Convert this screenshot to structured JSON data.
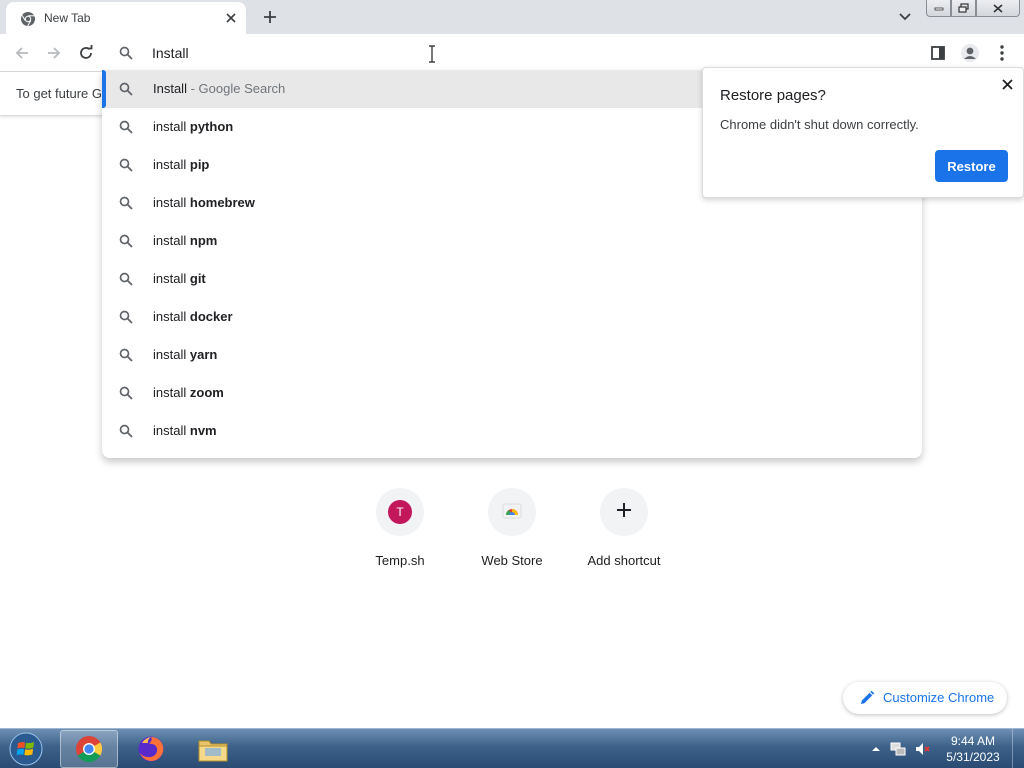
{
  "tab": {
    "title": "New Tab",
    "favicon": "chrome-icon"
  },
  "omnibox": {
    "value": "Install",
    "placeholder": ""
  },
  "infobar": {
    "text": "To get future G"
  },
  "suggestions": [
    {
      "prefix": "Install",
      "bold": "",
      "desc": "- Google Search",
      "selected": true
    },
    {
      "prefix": "install",
      "bold": "python"
    },
    {
      "prefix": "install",
      "bold": "pip"
    },
    {
      "prefix": "install",
      "bold": "homebrew"
    },
    {
      "prefix": "install",
      "bold": "npm"
    },
    {
      "prefix": "install",
      "bold": "git"
    },
    {
      "prefix": "install",
      "bold": "docker"
    },
    {
      "prefix": "install",
      "bold": "yarn"
    },
    {
      "prefix": "install",
      "bold": "zoom"
    },
    {
      "prefix": "install",
      "bold": "nvm"
    }
  ],
  "restore_bubble": {
    "title": "Restore pages?",
    "body": "Chrome didn't shut down correctly.",
    "button": "Restore"
  },
  "shortcuts": [
    {
      "label": "Temp.sh",
      "letter": "T",
      "icon": "letter-tile-icon"
    },
    {
      "label": "Web Store",
      "icon": "web-store-icon"
    },
    {
      "label": "Add shortcut",
      "icon": "plus-icon"
    }
  ],
  "customize": {
    "label": "Customize Chrome",
    "icon": "pencil-icon"
  },
  "taskbar": {
    "apps": [
      "chrome-icon",
      "firefox-icon",
      "file-explorer-icon"
    ],
    "clock": {
      "time": "9:44 AM",
      "date": "5/31/2023"
    }
  },
  "colors": {
    "accent": "#1a73e8",
    "taskbar": "#3d6189",
    "tile_letter_bg": "#c2185b"
  }
}
